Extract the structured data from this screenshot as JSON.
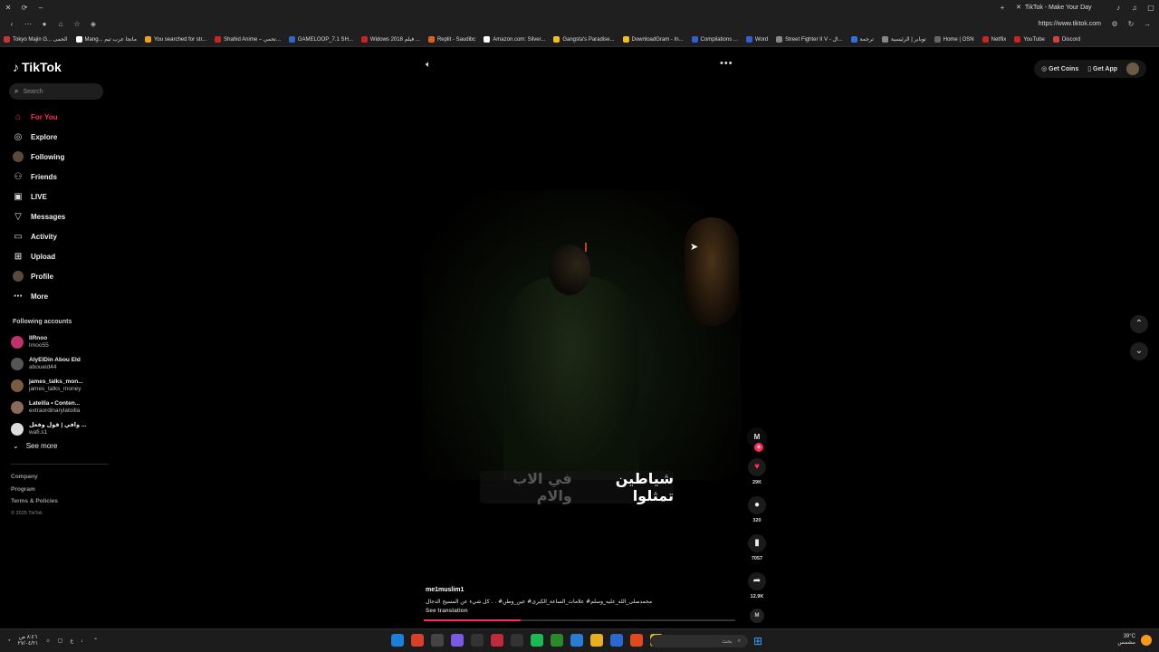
{
  "browser": {
    "tab_title": "TikTok - Make Your Day",
    "url": "https://www.tiktok.com",
    "bookmarks": [
      {
        "label": "Tokyo Majin G... الحمى",
        "color": "#cc3333"
      },
      {
        "label": "Mang... مانجا عرب تيم",
        "color": "#ffffff"
      },
      {
        "label": "You searched for str...",
        "color": "#f0a020"
      },
      {
        "label": "Shahid Anime – تحمي...",
        "color": "#cc2222"
      },
      {
        "label": "GAMELOOP_7.1 SH...",
        "color": "#2a6ad0"
      },
      {
        "label": "Widows 2018 فيلم ...",
        "color": "#cc2222"
      },
      {
        "label": "Replit - Saudibc",
        "color": "#e06020"
      },
      {
        "label": "Amazon.com: Silver...",
        "color": "#ffffff"
      },
      {
        "label": "Gangsta's Paradise...",
        "color": "#f0c020"
      },
      {
        "label": "DownloadGram - In...",
        "color": "#f0c020"
      },
      {
        "label": "Compilations ...",
        "color": "#3060d0"
      },
      {
        "label": "Word",
        "color": "#3060d0"
      },
      {
        "label": "Street Fighter II V - ال...",
        "color": "#888888"
      },
      {
        "label": "ترجمة",
        "color": "#3070e0"
      },
      {
        "label": "توبابر | الرئيسية",
        "color": "#888888"
      },
      {
        "label": "Home | OSN",
        "color": "#666666"
      },
      {
        "label": "Netflix",
        "color": "#cc2222"
      },
      {
        "label": "YouTube",
        "color": "#cc2222"
      },
      {
        "label": "Discord",
        "color": "#d04040"
      }
    ]
  },
  "app": {
    "logo": "TikTok",
    "search_placeholder": "Search",
    "nav": [
      {
        "label": "For You",
        "icon": "home-icon",
        "glyph": "⌂",
        "active": true
      },
      {
        "label": "Explore",
        "icon": "compass-icon",
        "glyph": "◎",
        "active": false
      },
      {
        "label": "Following",
        "icon": "avatar-icon",
        "glyph": "",
        "active": false
      },
      {
        "label": "Friends",
        "icon": "friends-icon",
        "glyph": "⚇",
        "active": false
      },
      {
        "label": "LIVE",
        "icon": "live-icon",
        "glyph": "▣",
        "active": false
      },
      {
        "label": "Messages",
        "icon": "messages-icon",
        "glyph": "▽",
        "active": false
      },
      {
        "label": "Activity",
        "icon": "activity-icon",
        "glyph": "▭",
        "active": false
      },
      {
        "label": "Upload",
        "icon": "upload-icon",
        "glyph": "⊞",
        "active": false
      },
      {
        "label": "Profile",
        "icon": "avatar-icon",
        "glyph": "",
        "active": false
      },
      {
        "label": "More",
        "icon": "more-icon",
        "glyph": "⋯",
        "active": false
      }
    ],
    "following_title": "Following accounts",
    "following": [
      {
        "name": "llRnoo",
        "user": "lrnoo55",
        "color": "#c0306a"
      },
      {
        "name": "AlyElDin Abou Eld",
        "user": "aboueid44",
        "color": "#555555"
      },
      {
        "name": "james_talks_mon...",
        "user": "james_talks_money",
        "color": "#7a5a40"
      },
      {
        "name": "Lateilla • Conten...",
        "user": "extraordinarylatoilla",
        "color": "#8a6a5a"
      },
      {
        "name": "وافي | قول وفعل ...",
        "user": "wafi.s1",
        "color": "#dddddd"
      }
    ],
    "see_more": "See more",
    "footer": [
      "Company",
      "Program",
      "Terms & Policies"
    ],
    "copyright": "© 2025 TikTok",
    "get_coins": "Get Coins",
    "get_app": "Get App"
  },
  "video": {
    "caption_highlight": "شياطين تمثلوا",
    "caption_dim": "في الاب والام",
    "author": "me1muslim1",
    "description": "محمدصلى_الله_عليه_وسلم# علامات_الساعة_الكبرى# عين_وطن# . . كل شيء عن المسيح الدجال",
    "see_translation": "See translation",
    "progress": 0.31,
    "likes": "29K",
    "comments": "320",
    "saves": "7057",
    "shares": "12.9K",
    "creator_badge": "M"
  },
  "taskbar": {
    "time": "٨:٤٦ ص",
    "date": "٢٧/٠٤/٢١",
    "search_label": "بحث",
    "weather": "39°C",
    "weather_sub": "مشمس"
  }
}
